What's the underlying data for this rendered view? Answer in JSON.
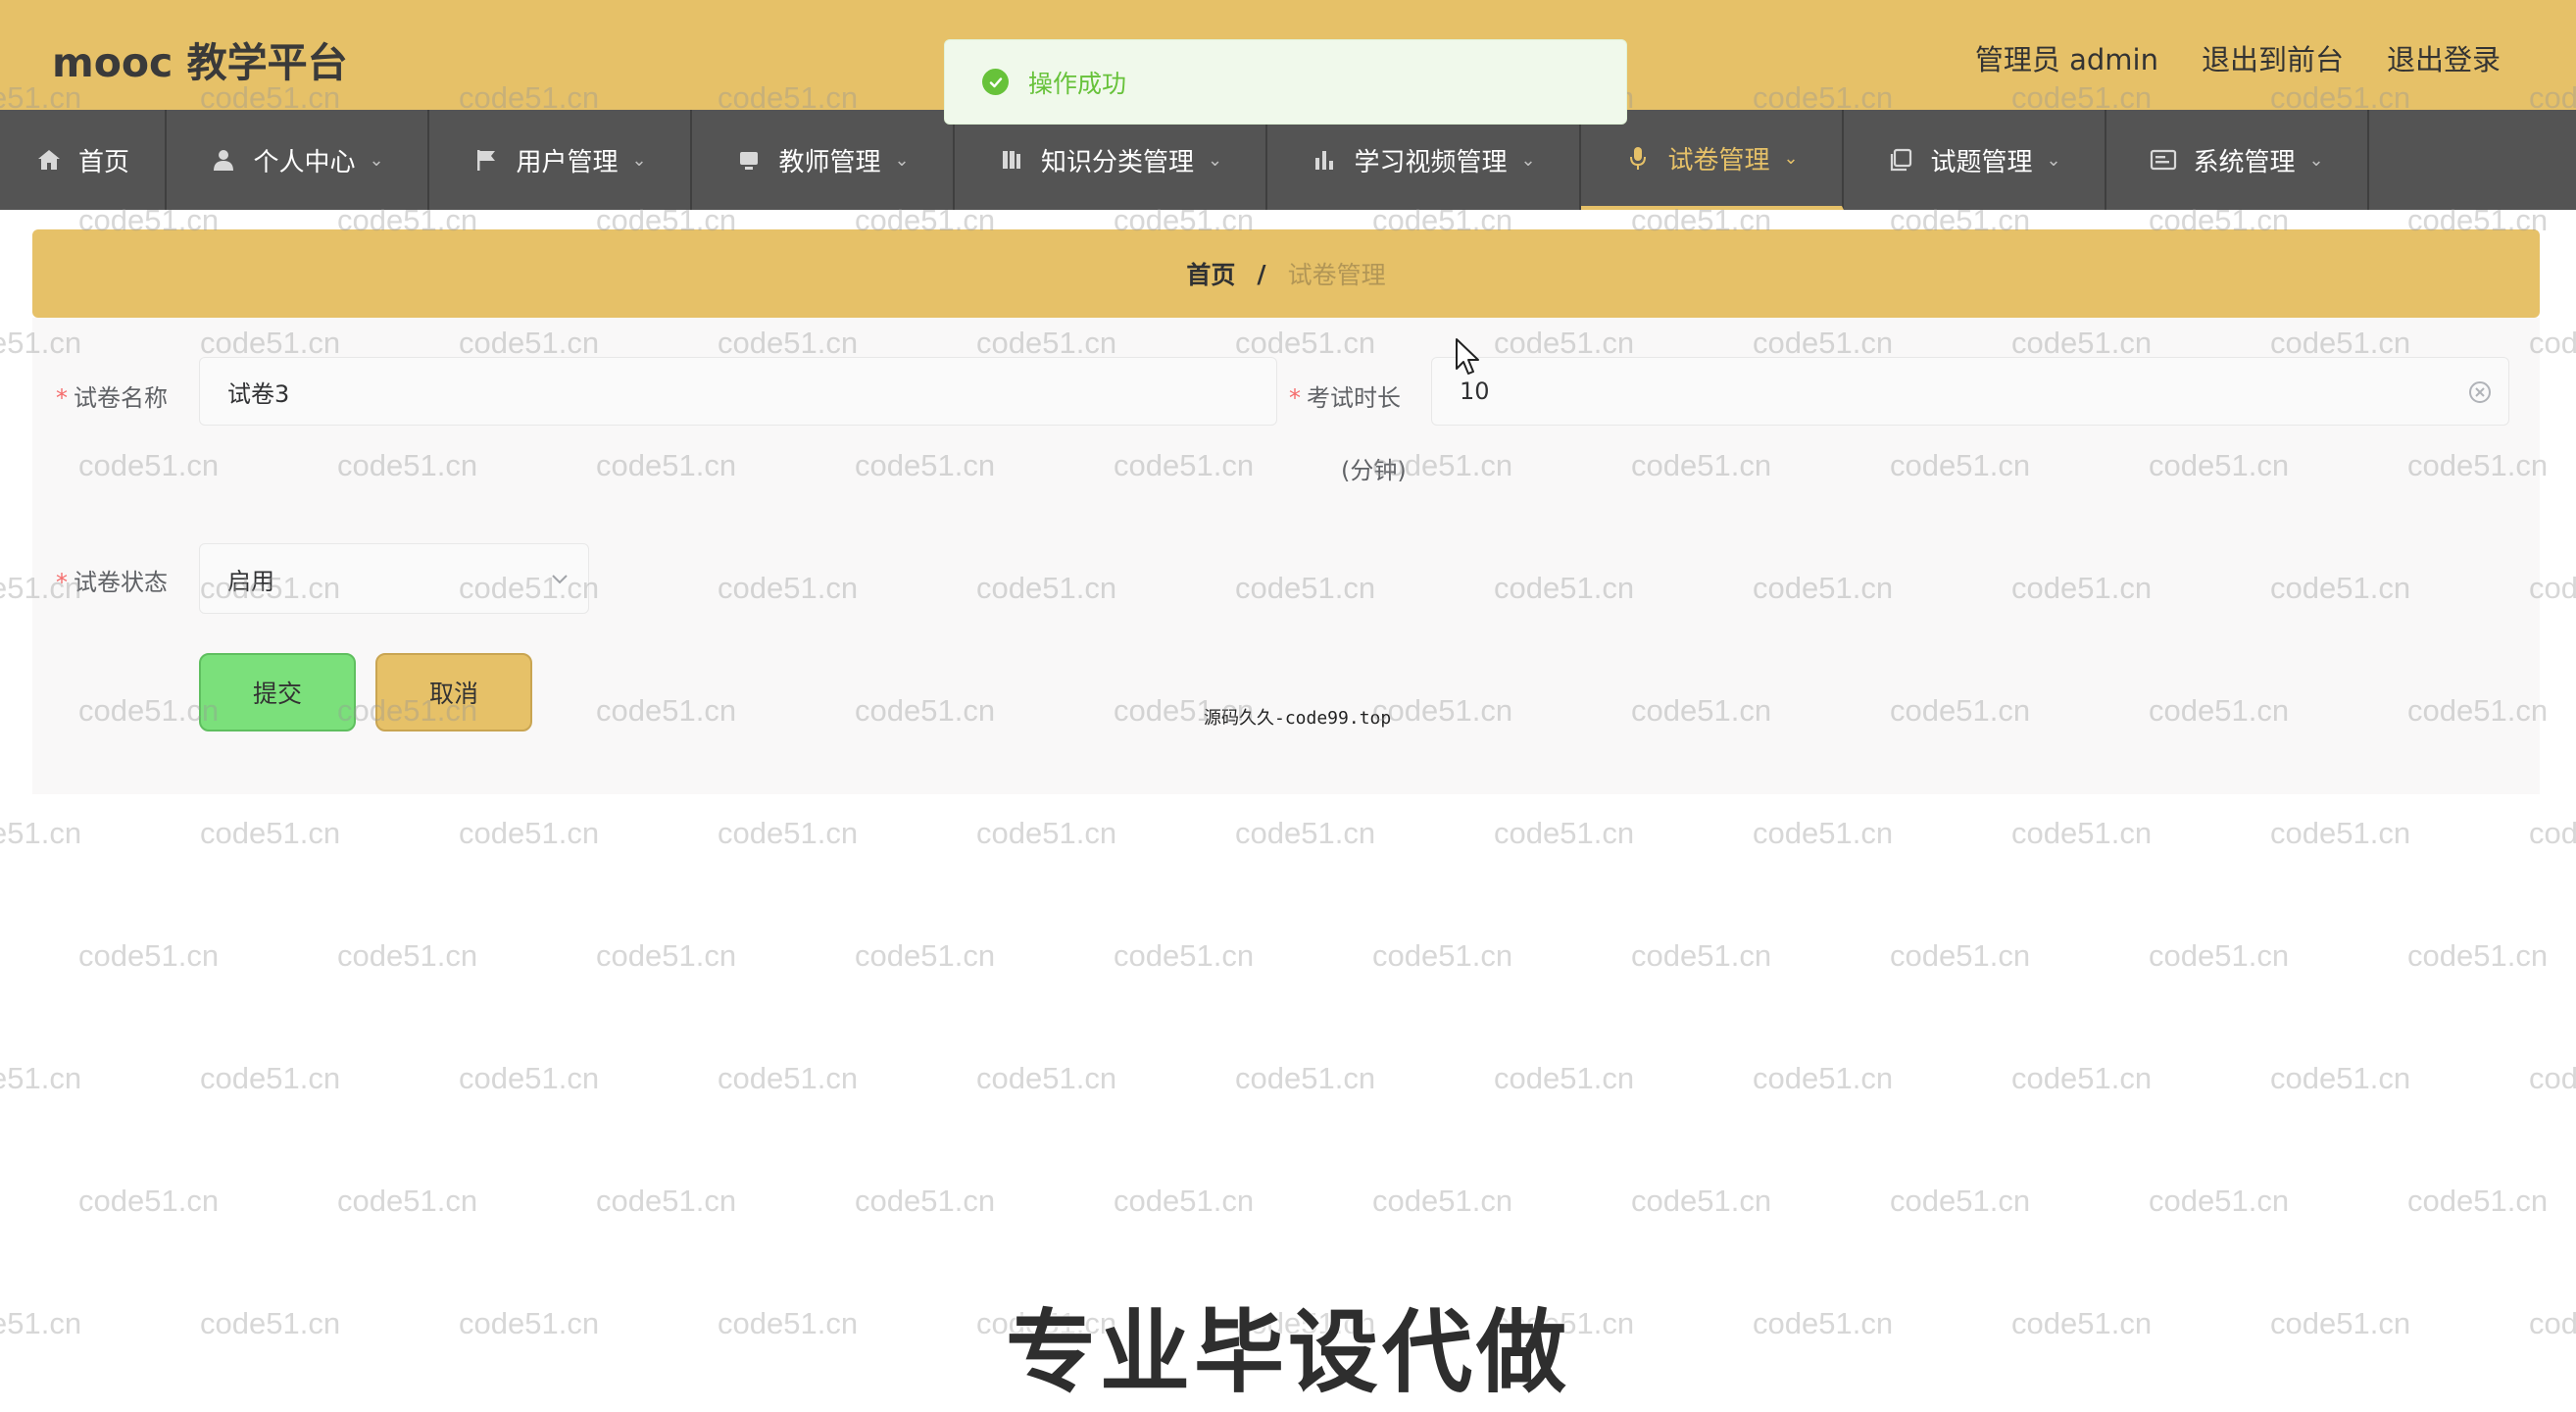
{
  "header": {
    "brand": "mooc 教学平台",
    "user_label": "管理员 admin",
    "to_front": "退出到前台",
    "logout": "退出登录"
  },
  "toast": {
    "text": "操作成功",
    "type": "success"
  },
  "nav": {
    "items": [
      {
        "label": "首页",
        "icon": "home-icon",
        "has_arrow": false,
        "active": false
      },
      {
        "label": "个人中心",
        "icon": "user-icon",
        "has_arrow": true,
        "active": false
      },
      {
        "label": "用户管理",
        "icon": "flag-icon",
        "has_arrow": true,
        "active": false
      },
      {
        "label": "教师管理",
        "icon": "monitor-icon",
        "has_arrow": true,
        "active": false
      },
      {
        "label": "知识分类管理",
        "icon": "books-icon",
        "has_arrow": true,
        "active": false
      },
      {
        "label": "学习视频管理",
        "icon": "bar-chart-icon",
        "has_arrow": true,
        "active": false
      },
      {
        "label": "试卷管理",
        "icon": "microphone-icon",
        "has_arrow": true,
        "active": true
      },
      {
        "label": "试题管理",
        "icon": "copy-icon",
        "has_arrow": true,
        "active": false
      },
      {
        "label": "系统管理",
        "icon": "settings-card-icon",
        "has_arrow": true,
        "active": false
      }
    ]
  },
  "breadcrumb": {
    "home": "首页",
    "separator": "/",
    "current": "试卷管理"
  },
  "form": {
    "name_label": "试卷名称",
    "name_value": "试卷3",
    "duration_label": "考试时长",
    "duration_value": "10",
    "duration_unit": "(分钟)",
    "status_label": "试卷状态",
    "status_value": "启用",
    "submit": "提交",
    "cancel": "取消"
  },
  "source_tag": "源码久久-code99.top",
  "watermark": "code51.cn",
  "promo": "专业毕设代做",
  "colors": {
    "header_bg": "#e6c168",
    "nav_bg": "#545454",
    "active_nav": "#e6c168",
    "success": "#67c23a",
    "submit_bg": "#7be07b"
  }
}
